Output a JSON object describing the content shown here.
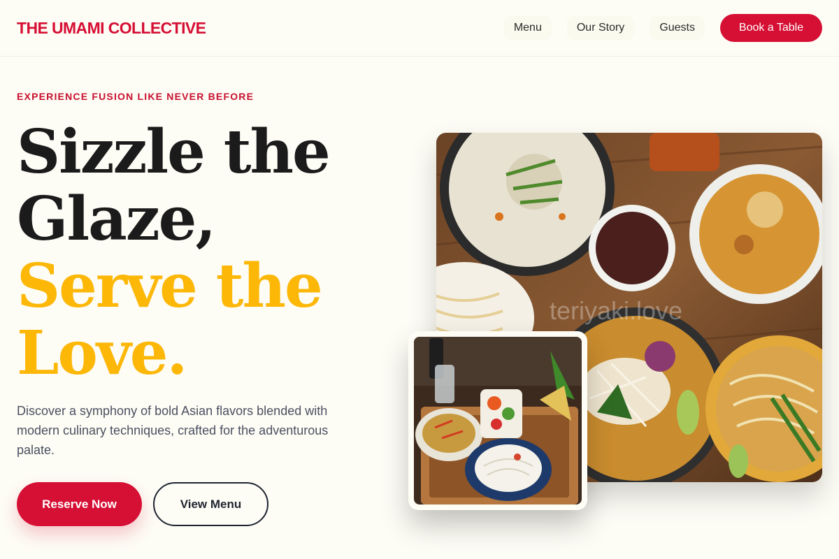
{
  "header": {
    "brand": "THE UMAMI COLLECTIVE",
    "nav": [
      "Menu",
      "Our Story",
      "Guests"
    ],
    "cta": "Book a Table"
  },
  "hero": {
    "eyebrow": "EXPERIENCE FUSION LIKE NEVER BEFORE",
    "headline": {
      "line1": "Sizzle the",
      "line2": "Glaze,",
      "line3": "Serve the",
      "line4": "Love."
    },
    "description": "Discover a symphony of bold Asian flavors blended with modern culinary techniques, crafted for the adventurous palate.",
    "primary_button": "Reserve Now",
    "secondary_button": "View Menu",
    "watermark": "teriyaki.love"
  },
  "colors": {
    "brand_red": "#d60f34",
    "accent_gold": "#fcb707",
    "background": "#fdfcf5"
  }
}
